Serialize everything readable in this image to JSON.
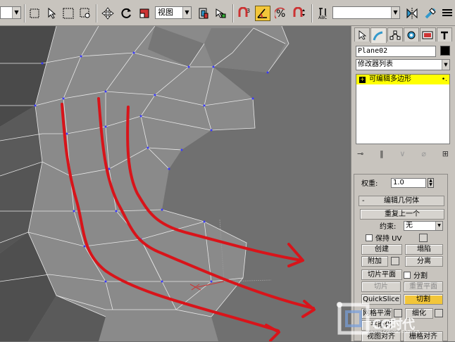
{
  "toolbar": {
    "view_dropdown": "视图",
    "empty_dropdown": "",
    "colors": {
      "bg": "#c8c4be",
      "active": "#f2c63a"
    },
    "icons": [
      "move-arrow-icon",
      "select-icon",
      "select-region-icon",
      "select-window-icon",
      "move-icon",
      "rotate-icon",
      "scale-icon",
      "mirror-icon",
      "snap-3-icon",
      "angle-snap-icon",
      "percent-snap-icon",
      "spinner-snap-icon",
      "named-selection-icon",
      "align-icon",
      "layer-icon"
    ]
  },
  "panel": {
    "object_name": "Plane02",
    "modifier_list_label": "修改器列表",
    "stack_item_label": "可编辑多边形",
    "weight_label": "权重:",
    "weight_value": "1.0",
    "rollout_title": "编辑几何体",
    "rollout_minus": "-",
    "repeat_last": "重复上一个",
    "constrain_label": "约束:",
    "constrain_value": "无",
    "preserve_uv": "保持 UV",
    "create": "创建",
    "collapse": "塌陷",
    "attach": "附加",
    "detach": "分离",
    "slice_plane": "切片平面",
    "split": "分割",
    "slice": "切片",
    "reset_plane": "重置平面",
    "quickslice": "QuickSlice",
    "cut": "切割",
    "msmooth": "网格平滑",
    "tessellate": "细化",
    "planarize": "平面化",
    "view_align": "视图对齐",
    "grid_align": "栅格对齐"
  },
  "watermark": {
    "brand": "CG时代",
    "url": "www.cgtime.com.cn"
  }
}
